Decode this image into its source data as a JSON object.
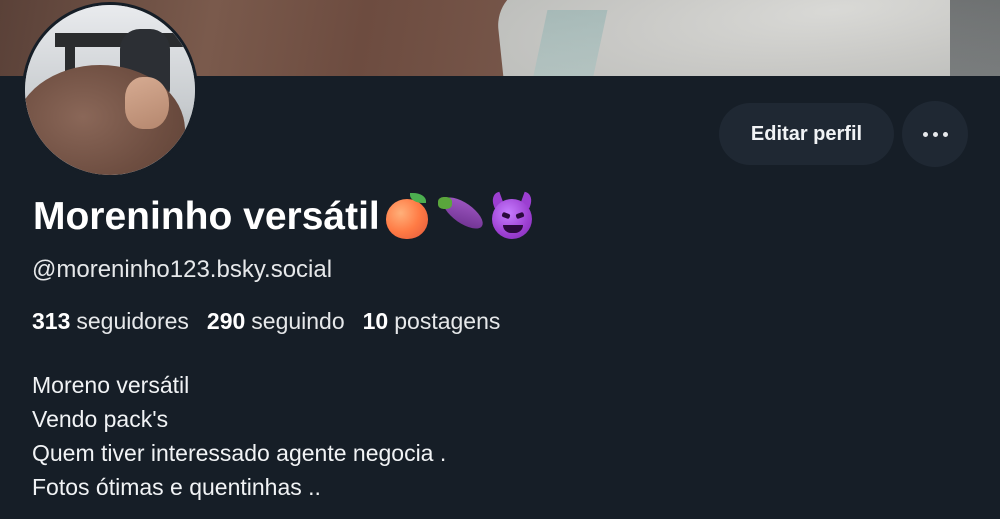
{
  "profile": {
    "display_name": "Moreninho versátil",
    "name_emojis": [
      "peach-icon",
      "eggplant-icon",
      "smiling-devil-icon"
    ],
    "handle": "@moreninho123.bsky.social",
    "stats": {
      "followers_count": "313",
      "followers_label": "seguidores",
      "following_count": "290",
      "following_label": "seguindo",
      "posts_count": "10",
      "posts_label": "postagens"
    },
    "bio_lines": [
      "Moreno versátil",
      "Vendo pack's",
      "Quem tiver interessado agente negocia .",
      "Fotos ótimas e quentinhas .."
    ]
  },
  "actions": {
    "edit_profile_label": "Editar perfil",
    "more_icon": "ellipsis-icon"
  },
  "colors": {
    "background": "#161e27",
    "button_background": "#1f2833",
    "text_primary": "#ffffff"
  }
}
